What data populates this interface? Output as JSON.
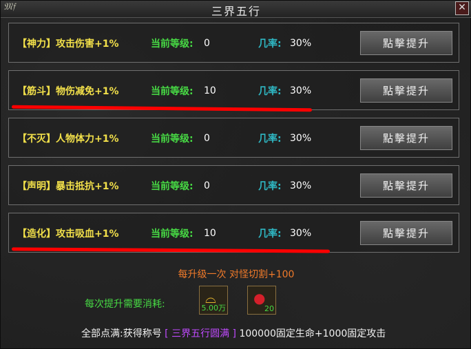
{
  "window": {
    "title": "三界五行",
    "logo_text": "ℭ𝔥𝔡",
    "close_icon": "close-icon"
  },
  "rows": [
    {
      "bracket_open": "【",
      "name": "神力",
      "bracket_close": "】",
      "effect": "攻击伤害+1%",
      "level_label": "当前等级:",
      "level": "0",
      "rate_label": "几率:",
      "rate": "30%",
      "button": "點擊提升"
    },
    {
      "bracket_open": "【",
      "name": "筋斗",
      "bracket_close": "】",
      "effect": "物伤减免+1%",
      "level_label": "当前等级:",
      "level": "10",
      "rate_label": "几率:",
      "rate": "30%",
      "button": "點擊提升"
    },
    {
      "bracket_open": "【",
      "name": "不灭",
      "bracket_close": "】",
      "effect": "人物体力+1%",
      "level_label": "当前等级:",
      "level": "0",
      "rate_label": "几率:",
      "rate": "30%",
      "button": "點擊提升"
    },
    {
      "bracket_open": "【",
      "name": "声明",
      "bracket_close": "】",
      "effect": "暴击抵抗+1%",
      "level_label": "当前等级:",
      "level": "0",
      "rate_label": "几率:",
      "rate": "30%",
      "button": "點擊提升"
    },
    {
      "bracket_open": "【",
      "name": "造化",
      "bracket_close": "】",
      "effect": "攻击吸血+1%",
      "level_label": "当前等级:",
      "level": "10",
      "rate_label": "几率:",
      "rate": "30%",
      "button": "點擊提升"
    }
  ],
  "info_line": "每升级一次 对怪切割+100",
  "cost": {
    "label": "每次提升需要消耗:",
    "items": [
      {
        "icon": "gold-ingot-icon",
        "amount": "5.00万"
      },
      {
        "icon": "red-orb-icon",
        "amount": "20"
      }
    ]
  },
  "final": {
    "prefix": "全部点满:获得称号 ",
    "title": "[ 三界五行圆满 ]",
    "suffix": " 100000固定生命+1000固定攻击"
  },
  "colors": {
    "level_label": "#47d944",
    "rate_label": "#2fb8c4",
    "attr": "#f2e04a",
    "highlight": "#c04bff",
    "annotation": "#ff0000"
  }
}
